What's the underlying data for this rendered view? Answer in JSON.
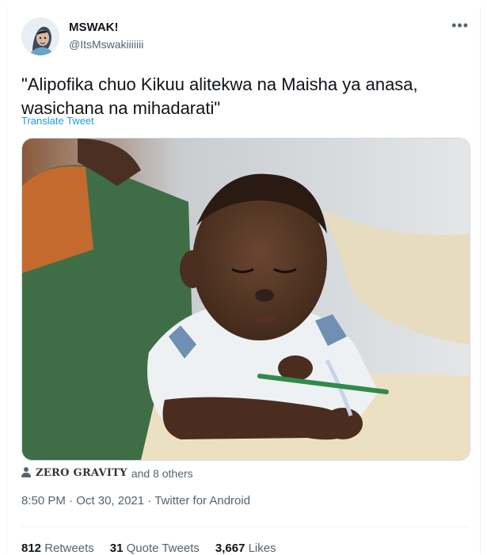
{
  "author": {
    "name": "MSWAK!",
    "handle": "@ItsMswakiiiiiii"
  },
  "tweet": {
    "text": "\"Alipofika chuo Kikuu alitekwa na Maisha ya anasa,\nwasichana na mihadarati\"",
    "translate_label": "Translate Tweet"
  },
  "liked_by": {
    "first": "ZERO GRAVITY",
    "rest": "and 8 others"
  },
  "meta": {
    "time": "8:50 PM",
    "sep1": " · ",
    "date": "Oct 30, 2021",
    "sep2": " · ",
    "source": "Twitter for Android"
  },
  "stats": {
    "retweets_count": "812",
    "retweets_label": "Retweets",
    "quotes_count": "31",
    "quotes_label": "Quote Tweets",
    "likes_count": "3,667",
    "likes_label": "Likes"
  },
  "icons": {
    "more": "more-options-icon",
    "person": "person-icon"
  },
  "colors": {
    "link": "#1d9bf0",
    "secondary_text": "#536471",
    "primary_text": "#0f1419"
  }
}
